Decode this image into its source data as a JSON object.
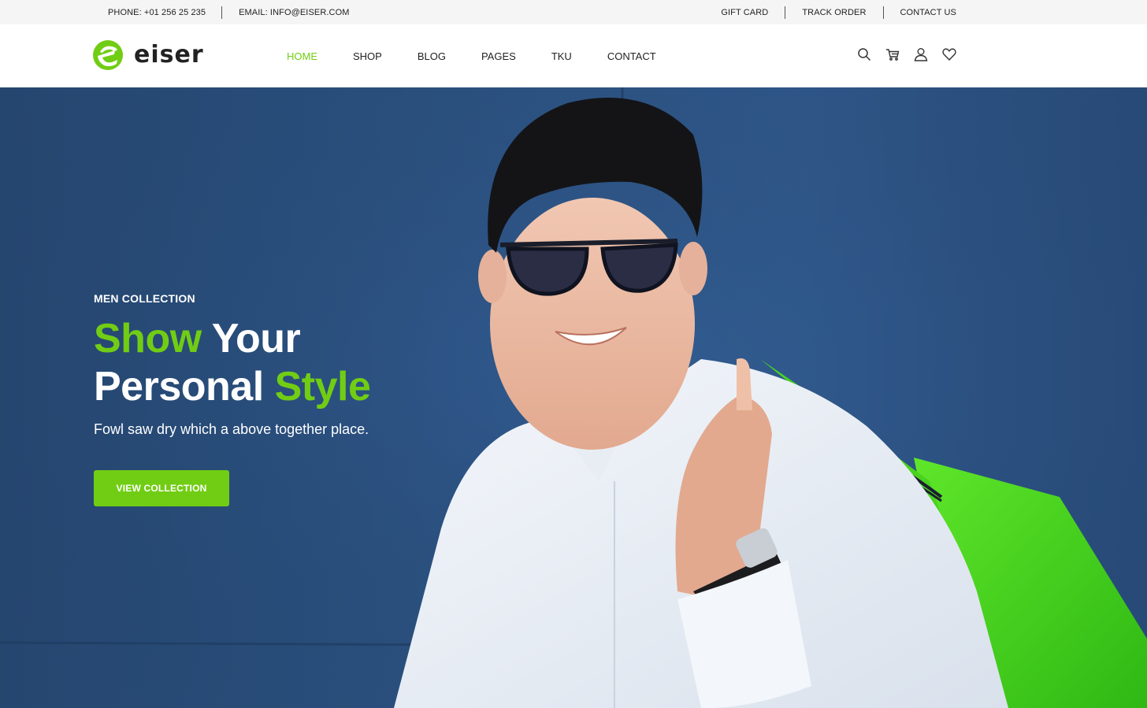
{
  "topbar": {
    "phone": "PHONE: +01 256 25 235",
    "email": "EMAIL: INFO@EISER.COM",
    "links": [
      "GIFT CARD",
      "TRACK ORDER",
      "CONTACT US"
    ]
  },
  "header": {
    "brand": "eiser",
    "nav": [
      "HOME",
      "SHOP",
      "BLOG",
      "PAGES",
      "TKU",
      "CONTACT"
    ],
    "active_nav": "HOME",
    "icons": [
      "search-icon",
      "cart-icon",
      "user-icon",
      "heart-icon"
    ]
  },
  "hero": {
    "eyebrow": "MEN COLLECTION",
    "title_word_1": "Show",
    "title_word_2": "Your",
    "title_word_3": "Personal",
    "title_word_4": "Style",
    "subtitle": "Fowl saw dry which a above together place.",
    "button_label": "VIEW COLLECTION"
  },
  "colors": {
    "accent": "#71cd14",
    "hero_background": "#2c5382",
    "topbar_background": "#f5f5f5"
  }
}
